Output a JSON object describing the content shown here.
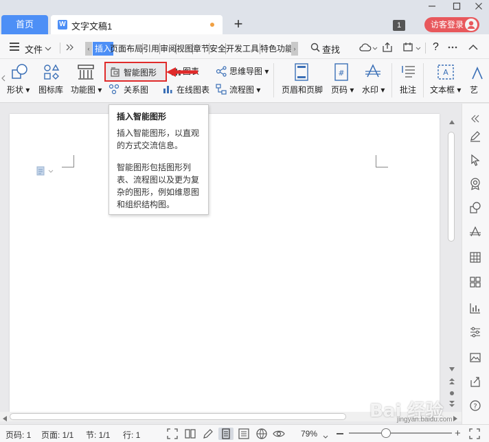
{
  "titlebar": {
    "home_tab": "首页",
    "doc_tab": "文字文稿1",
    "doc_icon": "W",
    "add_tab": "+",
    "window_count": "1",
    "visitor_login": "访客登录"
  },
  "menu": {
    "file": "文件",
    "find": "查找",
    "help": "?",
    "ribbon_tabs": [
      "插入",
      "页面布局",
      "引用",
      "审阅",
      "视图",
      "章节",
      "安全",
      "开发工具",
      "特色功能"
    ]
  },
  "ribbon": {
    "shape": "形状",
    "icon_library": "图标库",
    "function_chart": "功能图",
    "smart_graphic": "智能图形",
    "chart": "图表",
    "relation_graph": "关系图",
    "online_chart": "在线图表",
    "mind_map": "思维导图",
    "flowchart": "流程图",
    "header_footer": "页眉和页脚",
    "page_number": "页码",
    "watermark": "水印",
    "comment": "批注",
    "textbox": "文本框",
    "art": "艺"
  },
  "tooltip": {
    "title": "插入智能图形",
    "p1": "插入智能图形，以直观的方式交流信息。",
    "p2": "智能图形包括图形列表、流程图以及更为复杂的图形，例如维恩图和组织结构图。"
  },
  "status": {
    "page_no": "页码: 1",
    "pages": "页面: 1/1",
    "section": "节: 1/1",
    "row": "行: 1",
    "zoom": "79%"
  },
  "watermark_text": "Bai 经验",
  "watermark_sub": "jingyan.baidu.com",
  "colors": {
    "accent": "#4d8ff6",
    "highlight": "#e02a2a",
    "login": "#e8585c"
  }
}
